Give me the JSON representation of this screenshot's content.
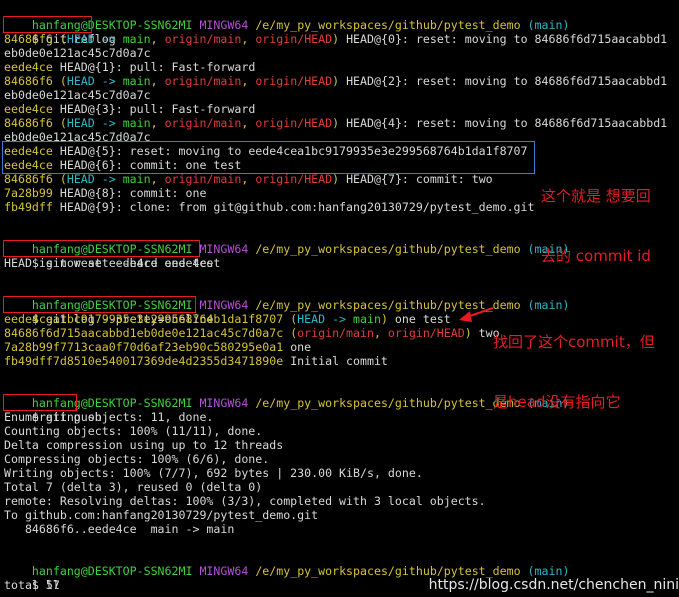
{
  "terminal": {
    "prompt": {
      "user_host": "hanfang@DESKTOP-SSN62MI",
      "shell": "MINGW64",
      "path": "/e/my_py_workspaces/github/pytest_demo",
      "branch": "(main)",
      "symbol": "$"
    },
    "commands": {
      "reflog": "git reflog",
      "reset": "git reset --hard eede4ce",
      "log": "git log --pretty=oneline",
      "push": "git push",
      "ll": "ll"
    },
    "reflog": {
      "l1_hash": "84686f6",
      "l1_head": "HEAD",
      "l1_main": "main",
      "l1_origin_main": "origin/main",
      "l1_origin_head": "origin/HEAD",
      "l1_text": "HEAD@{0}: reset: moving to 84686f6d715aacabbd1",
      "l1_wrap": "eb0de0e121ac45c7d0a7c",
      "l2_hash": "eede4ce",
      "l2_text": "HEAD@{1}: pull: Fast-forward",
      "l3_hash": "84686f6",
      "l3_text": "HEAD@{2}: reset: moving to 84686f6d715aacabbd1",
      "l3_wrap": "eb0de0e121ac45c7d0a7c",
      "l4_hash": "eede4ce",
      "l4_text": "HEAD@{3}: pull: Fast-forward",
      "l5_hash": "84686f6",
      "l5_text": "HEAD@{4}: reset: moving to 84686f6d715aacabbd1",
      "l5_wrap": "eb0de0e121ac45c7d0a7c",
      "l6_hash": "eede4ce",
      "l6_text": "HEAD@{5}: reset: moving to eede4cea1bc9179935e3e299568764b1da1f8707",
      "l7_hash": "eede4ce",
      "l7_text": "HEAD@{6}: commit: one test",
      "l8_hash": "84686f6",
      "l8_text": "HEAD@{7}: commit: two",
      "l9_hash": "7a28b99",
      "l9_text": "HEAD@{8}: commit: one",
      "l10_hash": "fb49dff",
      "l10_text": "HEAD@{9}: clone: from git@github.com:hanfang20130729/pytest_demo.git"
    },
    "reset_output": "HEAD is now at eede4ce one test",
    "log": {
      "l1_hash": "eede4cea1bc9179935e3e299568764b1da1f8707",
      "l1_head": "HEAD",
      "l1_arrow": "->",
      "l1_main": "main",
      "l1_msg": "one test",
      "l2_hash": "84686f6d715aacabbd1eb0de0e121ac45c7d0a7c",
      "l2_origin_main": "origin/main",
      "l2_origin_head": "origin/HEAD",
      "l2_msg": "two",
      "l3_hash": "7a28b99f7713caa0f70d6af23eb90c580295e0a1",
      "l3_msg": "one",
      "l4_hash": "fb49dff7d8510e540017369de4d2355d3471890e",
      "l4_msg": "Initial commit"
    },
    "push_output": [
      "Enumerating objects: 11, done.",
      "Counting objects: 100% (11/11), done.",
      "Delta compression using up to 12 threads",
      "Compressing objects: 100% (6/6), done.",
      "Writing objects: 100% (7/7), 692 bytes | 230.00 KiB/s, done.",
      "Total 7 (delta 3), reused 0 (delta 0)",
      "remote: Resolving deltas: 100% (3/3), completed with 3 local objects.",
      "To github.com:hanfang20130729/pytest_demo.git",
      "   84686f6..eede4ce  main -> main"
    ],
    "ll_output": "total 57"
  },
  "annotations": {
    "note1_line1": "这个就是 想要回",
    "note1_line2": "去的 commit id",
    "note2_line1": "找回了这个commit，但",
    "note2_line2": "是head没有指向它"
  },
  "watermark": "https://blog.csdn.net/chenchen_nini",
  "colors": {
    "background": "#000000",
    "prompt_user": "#3ecf3e",
    "prompt_shell": "#b44fd6",
    "prompt_path": "#d6c23a",
    "branch": "#2eb8c8",
    "hash": "#d6c23a",
    "ref_red": "#e03a3a",
    "annotation": "#e81b23",
    "highlight_box_blue": "#3a7bd5"
  }
}
